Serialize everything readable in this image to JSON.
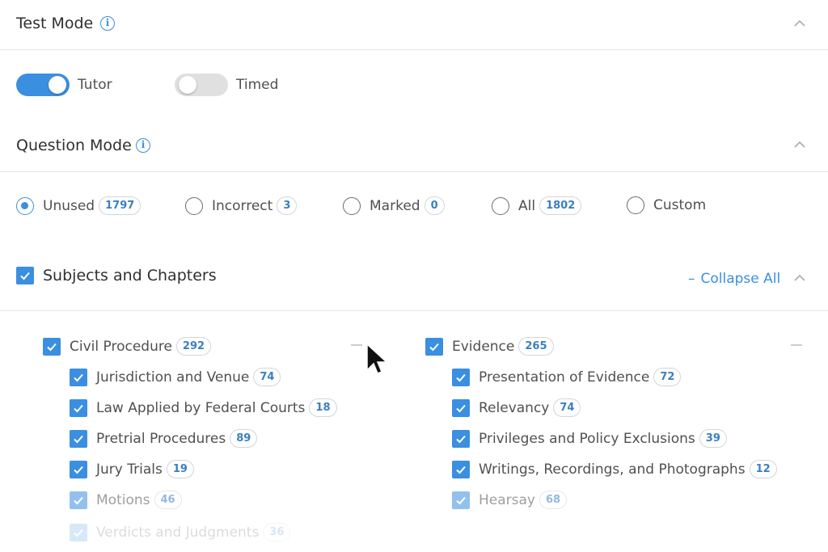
{
  "test_mode": {
    "title": "Test Mode",
    "toggles": [
      {
        "label": "Tutor",
        "on": true
      },
      {
        "label": "Timed",
        "on": false
      }
    ]
  },
  "question_mode": {
    "title": "Question Mode",
    "options": [
      {
        "label": "Unused",
        "count": "1797",
        "selected": true
      },
      {
        "label": "Incorrect",
        "count": "3",
        "selected": false
      },
      {
        "label": "Marked",
        "count": "0",
        "selected": false
      },
      {
        "label": "All",
        "count": "1802",
        "selected": false
      },
      {
        "label": "Custom",
        "count": "",
        "selected": false
      }
    ]
  },
  "subjects": {
    "title": "Subjects and Chapters",
    "collapse_label": "Collapse All",
    "groups": [
      {
        "name": "Civil Procedure",
        "count": "292",
        "chapters": [
          {
            "name": "Jurisdiction and Venue",
            "count": "74"
          },
          {
            "name": "Law Applied by Federal Courts",
            "count": "18"
          },
          {
            "name": "Pretrial Procedures",
            "count": "89"
          },
          {
            "name": "Jury Trials",
            "count": "19"
          },
          {
            "name": "Motions",
            "count": "46"
          },
          {
            "name": "Verdicts and Judgments",
            "count": "36"
          }
        ]
      },
      {
        "name": "Evidence",
        "count": "265",
        "chapters": [
          {
            "name": "Presentation of Evidence",
            "count": "72"
          },
          {
            "name": "Relevancy",
            "count": "74"
          },
          {
            "name": "Privileges and Policy Exclusions",
            "count": "39"
          },
          {
            "name": "Writings, Recordings, and Photographs",
            "count": "12"
          },
          {
            "name": "Hearsay",
            "count": "68"
          }
        ]
      }
    ]
  },
  "colors": {
    "accent": "#3b8fe0",
    "toggle_off": "#e0e0e0"
  },
  "icons": [
    "info-icon",
    "chevron-up-icon",
    "checkbox-checked-icon",
    "minus-icon",
    "mouse-cursor-icon"
  ]
}
